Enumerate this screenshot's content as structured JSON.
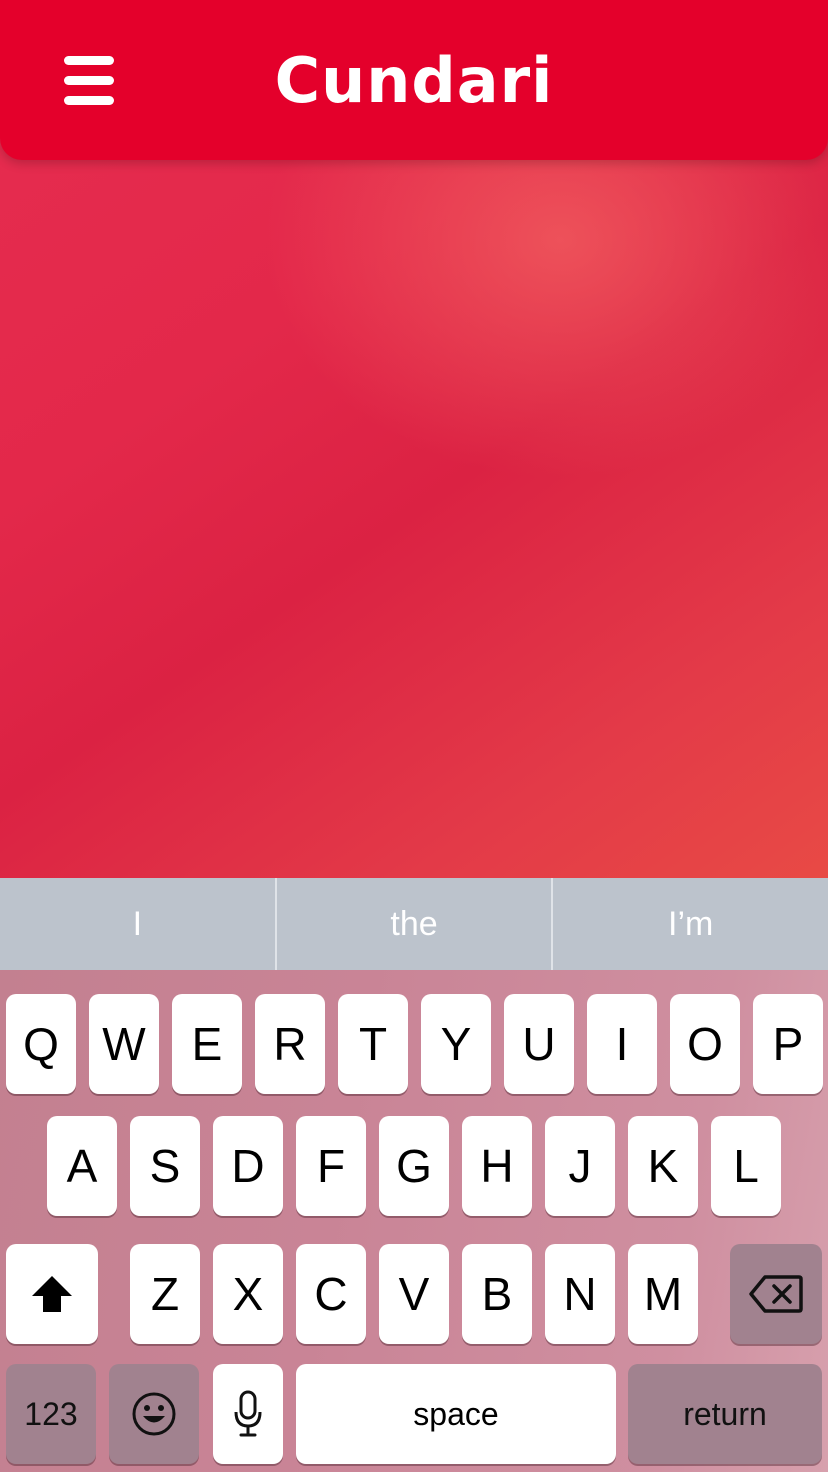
{
  "header": {
    "title": "Cundari",
    "menu_icon": "hamburger-menu-icon",
    "background": "#e4002b"
  },
  "suggestions": [
    "I",
    "the",
    "I’m"
  ],
  "keyboard": {
    "row1": [
      "Q",
      "W",
      "E",
      "R",
      "T",
      "Y",
      "U",
      "I",
      "O",
      "P"
    ],
    "row2": [
      "A",
      "S",
      "D",
      "F",
      "G",
      "H",
      "J",
      "K",
      "L"
    ],
    "row3": [
      "Z",
      "X",
      "C",
      "V",
      "B",
      "N",
      "M"
    ],
    "shift_icon": "shift-arrow-icon",
    "delete_icon": "backspace-icon",
    "numbers_label": "123",
    "emoji_icon": "emoji-smiley-icon",
    "mic_icon": "microphone-icon",
    "space_label": "space",
    "return_label": "return"
  }
}
